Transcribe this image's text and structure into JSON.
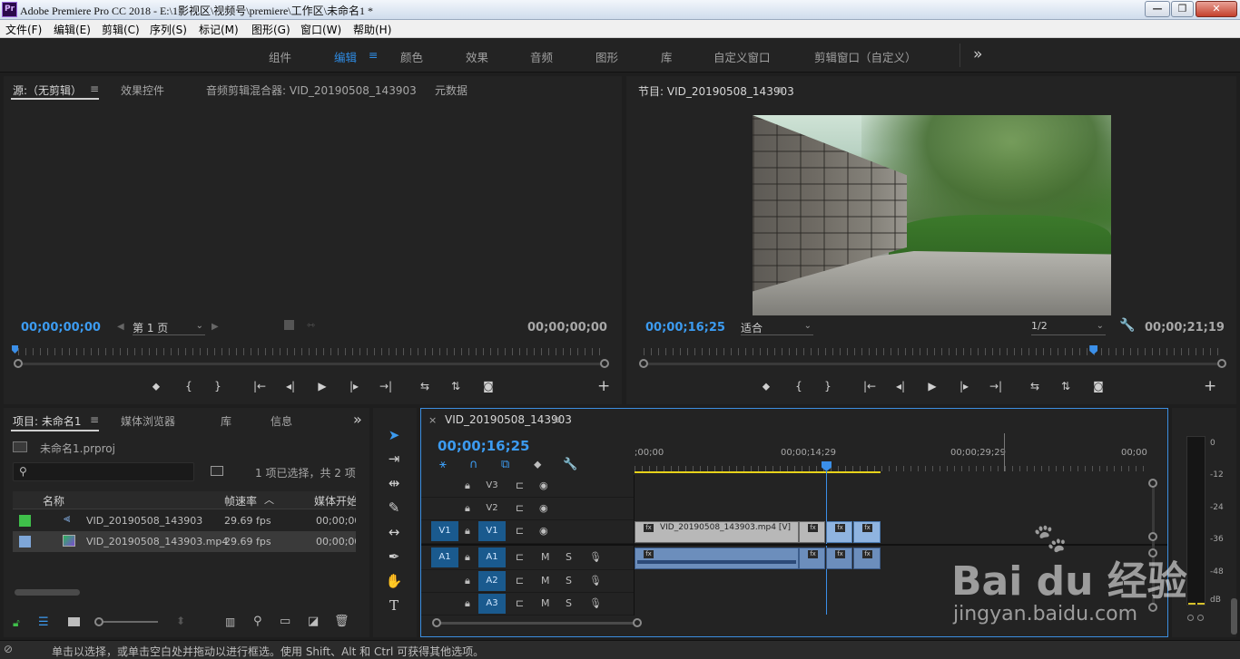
{
  "window": {
    "title": "Adobe Premiere Pro CC 2018 - E:\\1影视区\\视频号\\premiere\\工作区\\未命名1 *",
    "logo": "Pr",
    "controls": [
      "—",
      "❐",
      "✕"
    ]
  },
  "menu": [
    "文件(F)",
    "编辑(E)",
    "剪辑(C)",
    "序列(S)",
    "标记(M)",
    "图形(G)",
    "窗口(W)",
    "帮助(H)"
  ],
  "workspaces": {
    "items": [
      "组件",
      "编辑",
      "颜色",
      "效果",
      "音频",
      "图形",
      "库",
      "自定义窗口",
      "剪辑窗口（自定义）"
    ],
    "active": "编辑",
    "menu_icon": "≡",
    "overflow": "»"
  },
  "source_panel": {
    "tabs": [
      "源:（无剪辑）",
      "效果控件",
      "音频剪辑混合器: VID_20190508_143903",
      "元数据"
    ],
    "menu_icon": "≡",
    "timecode_in": "00;00;00;00",
    "page_select": "第 1 页",
    "timecode_out": "00;00;00;00"
  },
  "program_panel": {
    "title": "节目: VID_20190508_143903",
    "menu_icon": "≡",
    "timecode": "00;00;16;25",
    "fit": "适合",
    "resolution": "1/2",
    "duration": "00;00;21;19",
    "playhead_fraction": 0.775
  },
  "transport": [
    "⬥",
    "{",
    "}",
    "|←",
    "◂|",
    "▶",
    "|▸",
    "→|",
    "⇆",
    "⇅",
    "◙"
  ],
  "add_button": "+",
  "project_panel": {
    "tabs": [
      "项目: 未命名1",
      "媒体浏览器",
      "库",
      "信息"
    ],
    "menu_icon": "≡",
    "overflow": "»",
    "project_file": "未命名1.prproj",
    "selection_info": "1 项已选择，共 2 项",
    "columns": [
      "名称",
      "帧速率",
      "媒体开始"
    ],
    "rows": [
      {
        "name": "VID_20190508_143903",
        "fps": "29.69 fps",
        "start": "00;00;00;",
        "color": "#3fbf4a"
      },
      {
        "name": "VID_20190508_143903.mp4",
        "fps": "29.69 fps",
        "start": "00;00;00;",
        "color": "#7ea6d8"
      }
    ]
  },
  "timeline": {
    "close": "×",
    "sequence": "VID_20190508_143903",
    "menu_icon": "≡",
    "timecode": "00;00;16;25",
    "ruler": [
      ";00;00",
      "00;00;14;29",
      "00;00;29;29",
      "00;00"
    ],
    "tracks": [
      {
        "target": "",
        "name": "V3",
        "kind": "video"
      },
      {
        "target": "",
        "name": "V2",
        "kind": "video"
      },
      {
        "target": "V1",
        "name": "V1",
        "kind": "video"
      },
      {
        "target": "A1",
        "name": "A1",
        "kind": "audio"
      },
      {
        "target": "",
        "name": "A2",
        "kind": "audio"
      },
      {
        "target": "",
        "name": "A3",
        "kind": "audio"
      }
    ],
    "clip_label": "VID_20190508_143903.mp4 [V]",
    "fx_label": "fx",
    "mute": "M",
    "solo": "S"
  },
  "meter": {
    "labels": [
      "0",
      "-12",
      "-24",
      "-36",
      "-48",
      "dB"
    ]
  },
  "status_bar": {
    "text": "单击以选择，或单击空白处并拖动以进行框选。使用 Shift、Alt 和 Ctrl 可获得其他选项。"
  },
  "watermark": {
    "brand": "Bai du 经验",
    "url": "jingyan.baidu.com"
  },
  "colors": {
    "accent": "#2e8ce5",
    "work_area": "#e8d21a",
    "playhead": "#3b8fe8"
  }
}
